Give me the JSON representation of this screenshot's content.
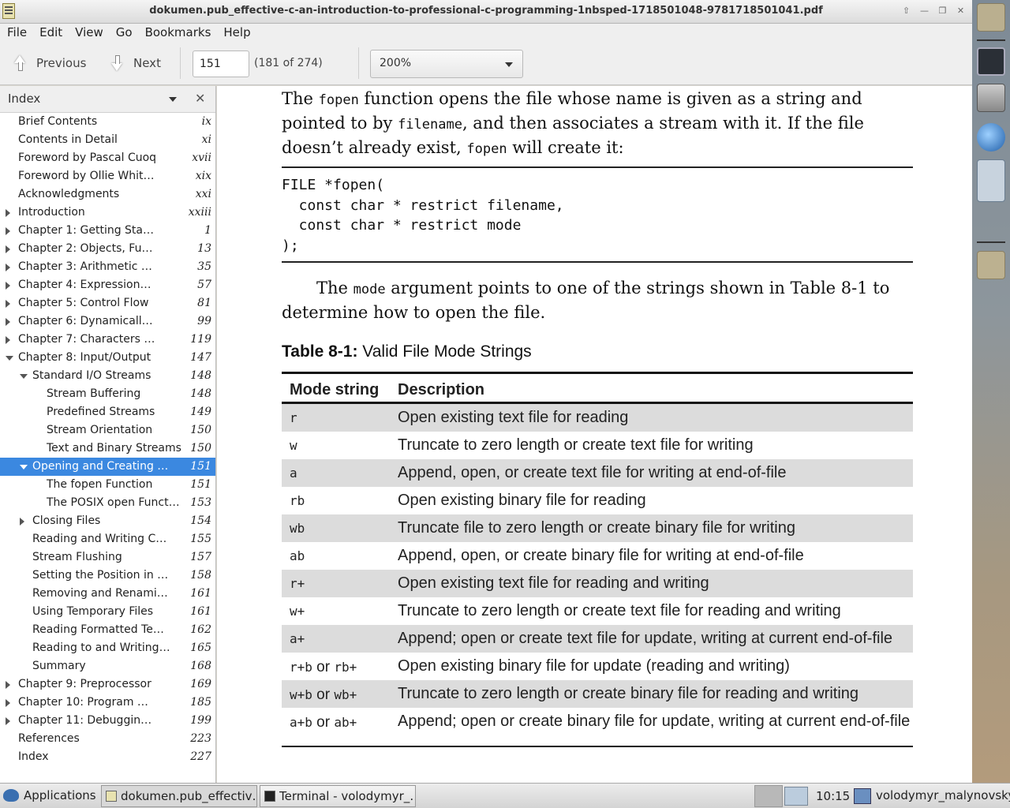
{
  "window": {
    "title": "dokumen.pub_effective-c-an-introduction-to-professional-c-programming-1nbsped-1718501048-9781718501041.pdf",
    "buttons": [
      "⇧",
      "—",
      "❐",
      "✕"
    ]
  },
  "menu": [
    "File",
    "Edit",
    "View",
    "Go",
    "Bookmarks",
    "Help"
  ],
  "toolbar": {
    "previous_label": "Previous",
    "next_label": "Next",
    "page_value": "151",
    "page_count": "(181 of 274)",
    "zoom": "200%"
  },
  "sidebar": {
    "title": "Index",
    "close": "✕",
    "items": [
      {
        "label": "Brief Contents",
        "page": "ix",
        "level": 0,
        "toggle": "none"
      },
      {
        "label": "Contents in Detail",
        "page": "xi",
        "level": 0,
        "toggle": "none"
      },
      {
        "label": "Foreword by Pascal Cuoq",
        "page": "xvii",
        "level": 0,
        "toggle": "none"
      },
      {
        "label": "Foreword by Ollie Whit…",
        "page": "xix",
        "level": 0,
        "toggle": "none"
      },
      {
        "label": "Acknowledgments",
        "page": "xxi",
        "level": 0,
        "toggle": "none"
      },
      {
        "label": "Introduction",
        "page": "xxiii",
        "level": 0,
        "toggle": "closed"
      },
      {
        "label": "Chapter 1: Getting Sta…",
        "page": "1",
        "level": 0,
        "toggle": "closed"
      },
      {
        "label": "Chapter 2: Objects, Fu…",
        "page": "13",
        "level": 0,
        "toggle": "closed"
      },
      {
        "label": "Chapter 3: Arithmetic …",
        "page": "35",
        "level": 0,
        "toggle": "closed"
      },
      {
        "label": "Chapter 4: Expression…",
        "page": "57",
        "level": 0,
        "toggle": "closed"
      },
      {
        "label": "Chapter 5: Control Flow",
        "page": "81",
        "level": 0,
        "toggle": "closed"
      },
      {
        "label": "Chapter 6: Dynamicall…",
        "page": "99",
        "level": 0,
        "toggle": "closed"
      },
      {
        "label": "Chapter 7: Characters …",
        "page": "119",
        "level": 0,
        "toggle": "closed"
      },
      {
        "label": "Chapter 8: Input/Output",
        "page": "147",
        "level": 0,
        "toggle": "open"
      },
      {
        "label": "Standard I/O Streams",
        "page": "148",
        "level": 1,
        "toggle": "open"
      },
      {
        "label": "Stream Buffering",
        "page": "148",
        "level": 2,
        "toggle": "none"
      },
      {
        "label": "Predefined Streams",
        "page": "149",
        "level": 2,
        "toggle": "none"
      },
      {
        "label": "Stream Orientation",
        "page": "150",
        "level": 2,
        "toggle": "none"
      },
      {
        "label": "Text and Binary Streams",
        "page": "150",
        "level": 2,
        "toggle": "none"
      },
      {
        "label": "Opening and Creating …",
        "page": "151",
        "level": 1,
        "toggle": "open",
        "selected": true
      },
      {
        "label": "The fopen Function",
        "page": "151",
        "level": 2,
        "toggle": "none"
      },
      {
        "label": "The POSIX open Funct…",
        "page": "153",
        "level": 2,
        "toggle": "none"
      },
      {
        "label": "Closing Files",
        "page": "154",
        "level": 1,
        "toggle": "closed"
      },
      {
        "label": "Reading and Writing C…",
        "page": "155",
        "level": 1,
        "toggle": "none"
      },
      {
        "label": "Stream Flushing",
        "page": "157",
        "level": 1,
        "toggle": "none"
      },
      {
        "label": "Setting the Position in …",
        "page": "158",
        "level": 1,
        "toggle": "none"
      },
      {
        "label": "Removing and Renami…",
        "page": "161",
        "level": 1,
        "toggle": "none"
      },
      {
        "label": "Using Temporary Files",
        "page": "161",
        "level": 1,
        "toggle": "none"
      },
      {
        "label": "Reading Formatted Te…",
        "page": "162",
        "level": 1,
        "toggle": "none"
      },
      {
        "label": "Reading to and Writing…",
        "page": "165",
        "level": 1,
        "toggle": "none"
      },
      {
        "label": "Summary",
        "page": "168",
        "level": 1,
        "toggle": "none"
      },
      {
        "label": "Chapter 9: Preprocessor",
        "page": "169",
        "level": 0,
        "toggle": "closed"
      },
      {
        "label": "Chapter 10: Program …",
        "page": "185",
        "level": 0,
        "toggle": "closed"
      },
      {
        "label": "Chapter 11: Debuggin…",
        "page": "199",
        "level": 0,
        "toggle": "closed"
      },
      {
        "label": "References",
        "page": "223",
        "level": 0,
        "toggle": "none"
      },
      {
        "label": "Index",
        "page": "227",
        "level": 0,
        "toggle": "none"
      }
    ]
  },
  "document": {
    "para1": [
      {
        "t": "The ",
        "code": false
      },
      {
        "t": "fopen",
        "code": true
      },
      {
        "t": " function opens the file whose name is given as a string and pointed to by ",
        "code": false
      },
      {
        "t": "filename",
        "code": true
      },
      {
        "t": ", and then associates a stream with it. If the file doesn’t already exist, ",
        "code": false
      },
      {
        "t": "fopen",
        "code": true
      },
      {
        "t": " will create it:",
        "code": false
      }
    ],
    "code": "FILE *fopen(\n  const char * restrict filename,\n  const char * restrict mode\n);",
    "para2": [
      {
        "t": "The ",
        "code": false
      },
      {
        "t": "mode",
        "code": true
      },
      {
        "t": " argument points to one of the strings shown in Table 8-1 to determine how to open the file.",
        "code": false
      }
    ],
    "table_caption_bold": "Table 8-1:",
    "table_caption_rest": " Valid File Mode Strings",
    "table_headers": [
      "Mode string",
      "Description"
    ],
    "table_rows": [
      {
        "mode": [
          "r"
        ],
        "desc": "Open existing text file for reading"
      },
      {
        "mode": [
          "w"
        ],
        "desc": "Truncate to zero length or create text file for writing"
      },
      {
        "mode": [
          "a"
        ],
        "desc": "Append, open, or create text file for writing at end-of-file"
      },
      {
        "mode": [
          "rb"
        ],
        "desc": "Open existing binary file for reading"
      },
      {
        "mode": [
          "wb"
        ],
        "desc": "Truncate file to zero length or create binary file for writing"
      },
      {
        "mode": [
          "ab"
        ],
        "desc": "Append, open, or create binary file for writing at end-of-file"
      },
      {
        "mode": [
          "r+"
        ],
        "desc": "Open existing text file for reading and writing"
      },
      {
        "mode": [
          "w+"
        ],
        "desc": "Truncate to zero length or create text file for reading and writing"
      },
      {
        "mode": [
          "a+"
        ],
        "desc": "Append; open or create text file for update, writing at current end-of-file"
      },
      {
        "mode": [
          "r+b",
          "rb+"
        ],
        "desc": "Open existing binary file for update (reading and writing)"
      },
      {
        "mode": [
          "w+b",
          "wb+"
        ],
        "desc": "Truncate to zero length or create binary file for reading and writing"
      },
      {
        "mode": [
          "a+b",
          "ab+"
        ],
        "desc": "Append; open or create binary file for update, writing at current end-of-file"
      }
    ],
    "or_word": " or "
  },
  "taskbar": {
    "apps_label": "Applications",
    "tasks": [
      "dokumen.pub_effectiv…",
      "Terminal - volodymyr_…"
    ],
    "clock": "10:15",
    "user": "volodymyr_malynovskyi"
  },
  "colors": {
    "selection": "#3b88e0",
    "table_shade": "#dcdcdc"
  }
}
